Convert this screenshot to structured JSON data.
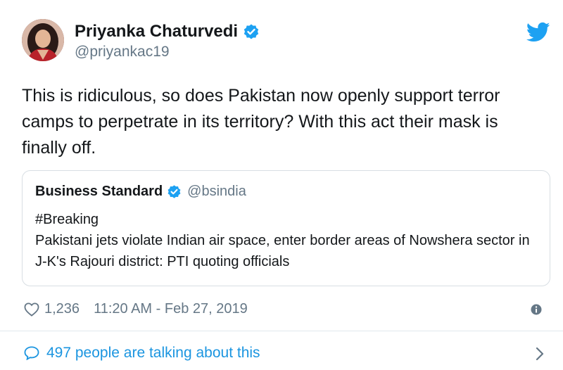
{
  "author": {
    "name": "Priyanka Chaturvedi",
    "handle": "@priyankac19",
    "verified": true
  },
  "tweet": {
    "text": "This is ridiculous, so does Pakistan now openly support terror camps to perpetrate in its territory? With this act their mask is finally off."
  },
  "quoted_tweet": {
    "name": "Business Standard",
    "handle": "@bsindia",
    "verified": true,
    "line1": "#Breaking",
    "line2": "Pakistani jets violate Indian air space, enter border areas of Nowshera sector in J-K's Rajouri district: PTI quoting officials"
  },
  "meta": {
    "likes": "1,236",
    "timestamp": "11:20 AM - Feb 27, 2019"
  },
  "footer": {
    "talking": "497 people are talking about this"
  },
  "icons": {
    "brand": "twitter-bird-icon",
    "verified": "verified-badge-icon",
    "like": "heart-icon",
    "info": "info-icon",
    "reply": "speech-bubble-icon",
    "more": "chevron-right-icon"
  },
  "colors": {
    "twitter_blue": "#1da1f2",
    "link_blue": "#1b95e0",
    "secondary_text": "#657786",
    "border": "#d8dee3"
  }
}
